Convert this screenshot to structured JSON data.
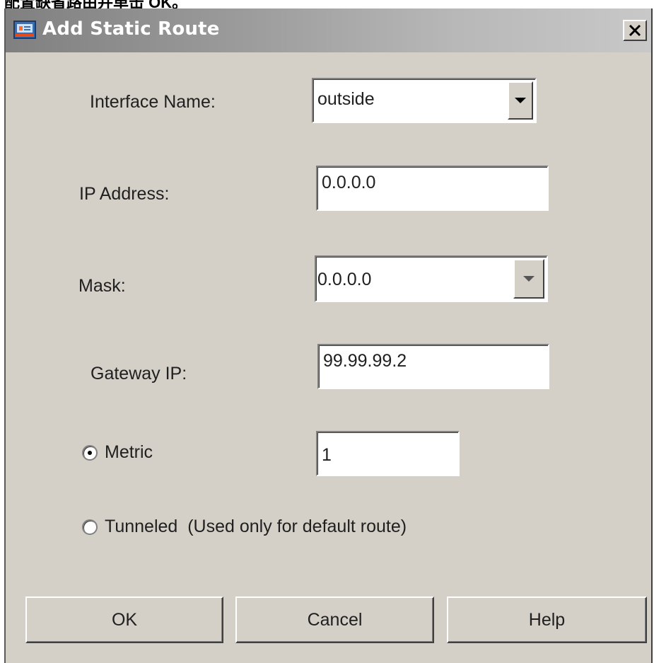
{
  "caption": "配置缺省路由并单击 OK。",
  "dialog": {
    "title": "Add Static Route",
    "close_glyph": "✕"
  },
  "form": {
    "interface_name": {
      "label": "Interface Name:",
      "value": "outside"
    },
    "ip_address": {
      "label": "IP Address:",
      "value": "0.0.0.0"
    },
    "mask": {
      "label": "Mask:",
      "value": "0.0.0.0"
    },
    "gateway_ip": {
      "label": "Gateway IP:",
      "value": "99.99.99.2"
    },
    "metric": {
      "label": "Metric",
      "value": "1",
      "selected": true
    },
    "tunneled": {
      "label": "Tunneled  (Used only for default route)",
      "selected": false
    }
  },
  "buttons": {
    "ok": "OK",
    "cancel": "Cancel",
    "help": "Help"
  }
}
